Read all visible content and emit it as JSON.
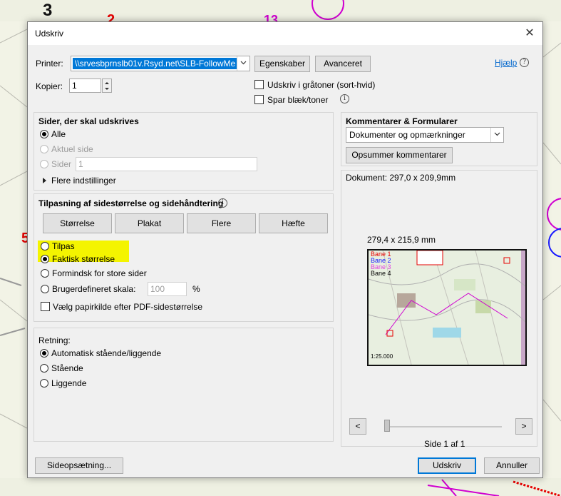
{
  "dialog": {
    "title": "Udskriv",
    "printer_label": "Printer:",
    "printer_value": "\\\\srvesbprnslb01v.Rsyd.net\\SLB-FollowMe",
    "properties_button": "Egenskaber",
    "advanced_button": "Avanceret",
    "help_link": "Hjælp",
    "copies_label": "Kopier:",
    "copies_value": "1",
    "grayscale_label": "Udskriv i gråtoner (sort-hvid)",
    "save_ink_label": "Spar blæk/toner"
  },
  "pages": {
    "title": "Sider, der skal udskrives",
    "all": "Alle",
    "current": "Aktuel side",
    "pages_label": "Sider",
    "pages_value": "1",
    "more": "Flere indstillinger"
  },
  "sizing": {
    "title": "Tilpasning af sidestørrelse og sidehåndtering",
    "tabs": [
      "Størrelse",
      "Plakat",
      "Flere",
      "Hæfte"
    ],
    "fit": "Tilpas",
    "actual": "Faktisk størrelse",
    "shrink": "Formindsk for store sider",
    "custom": "Brugerdefineret skala:",
    "custom_value": "100",
    "percent": "%",
    "paper_source": "Vælg papirkilde efter PDF-sidestørrelse"
  },
  "orientation": {
    "title": "Retning:",
    "auto": "Automatisk stående/liggende",
    "portrait": "Stående",
    "landscape": "Liggende"
  },
  "comments": {
    "title": "Kommentarer & Formularer",
    "select_value": "Dokumenter og opmærkninger",
    "summarize_button": "Opsummer kommentarer"
  },
  "preview": {
    "document_size": "Dokument: 297,0 x 209,9mm",
    "paper_size": "279,4 x 215,9 mm",
    "legend": [
      "Bane 1",
      "Bane 2",
      "Bane 3",
      "Bane 4"
    ],
    "scale": "1:25.000",
    "prev_button": "<",
    "next_button": ">",
    "page_info": "Side 1 af 1"
  },
  "footer": {
    "page_setup_button": "Sideopsætning...",
    "print_button": "Udskriv",
    "cancel_button": "Annuller"
  },
  "colors": {
    "accent": "#0078d7",
    "highlight": "#f4f400",
    "bane1": "#e60000",
    "bane2": "#1a1aff",
    "bane3": "#e040e0",
    "bane4": "#000000"
  }
}
